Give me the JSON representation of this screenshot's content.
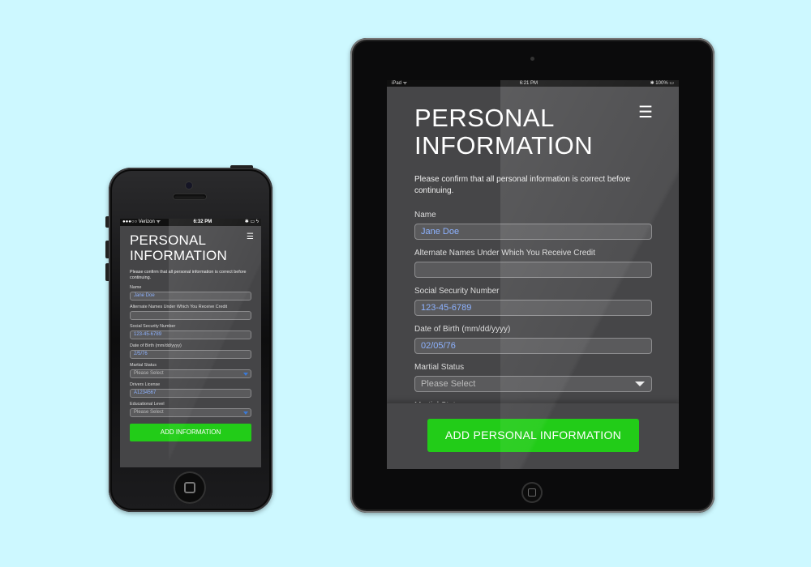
{
  "phone": {
    "status": {
      "carrier": "●●●○○ Verizon ᯤ",
      "time": "6:32 PM",
      "battery": "✱ ▭ ϟ"
    },
    "title_line1": "PERSONAL",
    "title_line2": "INFORMATION",
    "menu_icon": "☰",
    "description": "Please confirm that all personal information is correct before continuing.",
    "fields": [
      {
        "label": "Name",
        "value": "Jane Doe"
      },
      {
        "label": "Alternate Names Under Which You Receive Credit",
        "value": ""
      },
      {
        "label": "Social Security Number",
        "value": "123-45-6789"
      },
      {
        "label": "Date of Birth (mm/dd/yyyy)",
        "value": "2/5/76"
      },
      {
        "label": "Martial Status",
        "value": "Please Select"
      },
      {
        "label": "Drivers License",
        "value": "A1234567"
      },
      {
        "label": "Educational Level",
        "value": "Please Select"
      }
    ],
    "button": "ADD INFORMATION"
  },
  "tablet": {
    "status": {
      "device": "iPad ᯤ",
      "time": "6:21 PM",
      "battery": "✱ 100% ▭"
    },
    "title_line1": "PERSONAL",
    "title_line2": "INFORMATION",
    "menu_icon": "☰",
    "description": "Please confirm that all personal information is correct before continuing.",
    "fields": [
      {
        "label": "Name",
        "value": "Jane Doe"
      },
      {
        "label": "Alternate Names Under Which You Receive Credit",
        "value": ""
      },
      {
        "label": "Social Security Number",
        "value": "123-45-6789"
      },
      {
        "label": "Date of Birth (mm/dd/yyyy)",
        "value": "02/05/76"
      },
      {
        "label": "Martial Status",
        "value": "Please Select"
      },
      {
        "label": "Martial Status",
        "value": ""
      }
    ],
    "button": "ADD PERSONAL INFORMATION"
  },
  "colors": {
    "background": "#cdf8ff",
    "button_green": "#22cc18",
    "input_text": "#8db2ff"
  }
}
